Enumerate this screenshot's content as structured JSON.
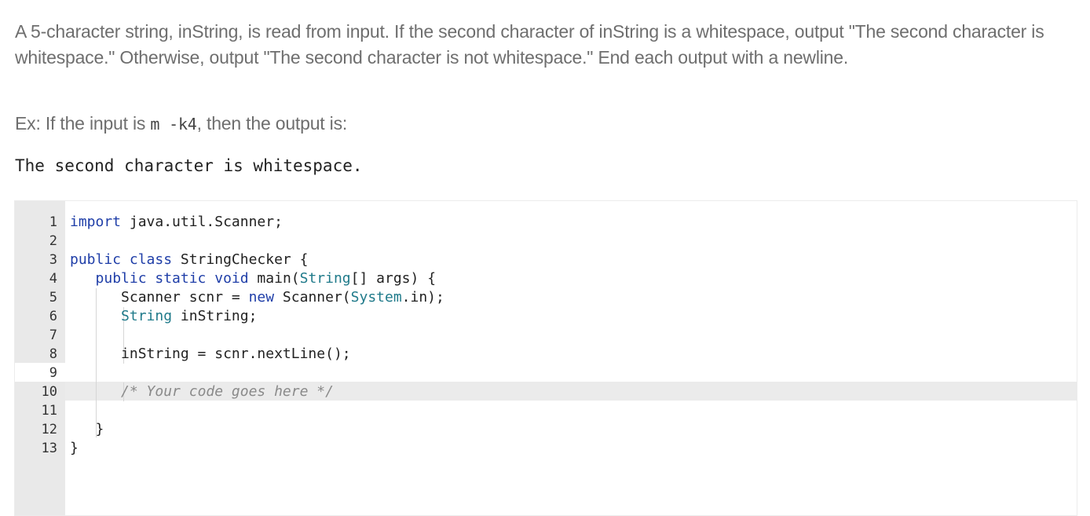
{
  "prompt": {
    "paragraph": "A 5-character string, inString, is read from input. If the second character of inString is a whitespace, output \"The second character is whitespace.\" Otherwise, output \"The second character is not whitespace.\" End each output with a newline.",
    "example_prefix": "Ex: If the input is ",
    "example_input": "m -k4",
    "example_suffix": ", then the output is:",
    "sample_output": "The second character is whitespace."
  },
  "editor": {
    "lines": [
      {
        "n": "1",
        "tokens": [
          [
            "kw",
            "import"
          ],
          [
            "pl",
            " java.util.Scanner;"
          ]
        ]
      },
      {
        "n": "2",
        "tokens": []
      },
      {
        "n": "3",
        "tokens": [
          [
            "kw",
            "public class"
          ],
          [
            "pl",
            " StringChecker {"
          ]
        ]
      },
      {
        "n": "4",
        "tokens": [
          [
            "pl",
            "   "
          ],
          [
            "kw",
            "public static void"
          ],
          [
            "pl",
            " main("
          ],
          [
            "ty",
            "String"
          ],
          [
            "pl",
            "[] args) {"
          ]
        ]
      },
      {
        "n": "5",
        "tokens": [
          [
            "pl",
            "      Scanner scnr = "
          ],
          [
            "kw",
            "new"
          ],
          [
            "pl",
            " Scanner("
          ],
          [
            "ty",
            "System"
          ],
          [
            "pl",
            ".in);"
          ]
        ]
      },
      {
        "n": "6",
        "tokens": [
          [
            "pl",
            "      "
          ],
          [
            "ty",
            "String"
          ],
          [
            "pl",
            " inString;"
          ]
        ]
      },
      {
        "n": "7",
        "tokens": []
      },
      {
        "n": "8",
        "tokens": [
          [
            "pl",
            "      inString = scnr.nextLine();"
          ]
        ]
      },
      {
        "n": "9",
        "tokens": []
      },
      {
        "n": "10",
        "tokens": [
          [
            "pl",
            "      "
          ],
          [
            "cm",
            "/* Your code goes here */"
          ]
        ]
      },
      {
        "n": "11",
        "tokens": []
      },
      {
        "n": "12",
        "tokens": [
          [
            "pl",
            "   }"
          ]
        ]
      },
      {
        "n": "13",
        "tokens": [
          [
            "pl",
            "}"
          ]
        ]
      }
    ]
  }
}
